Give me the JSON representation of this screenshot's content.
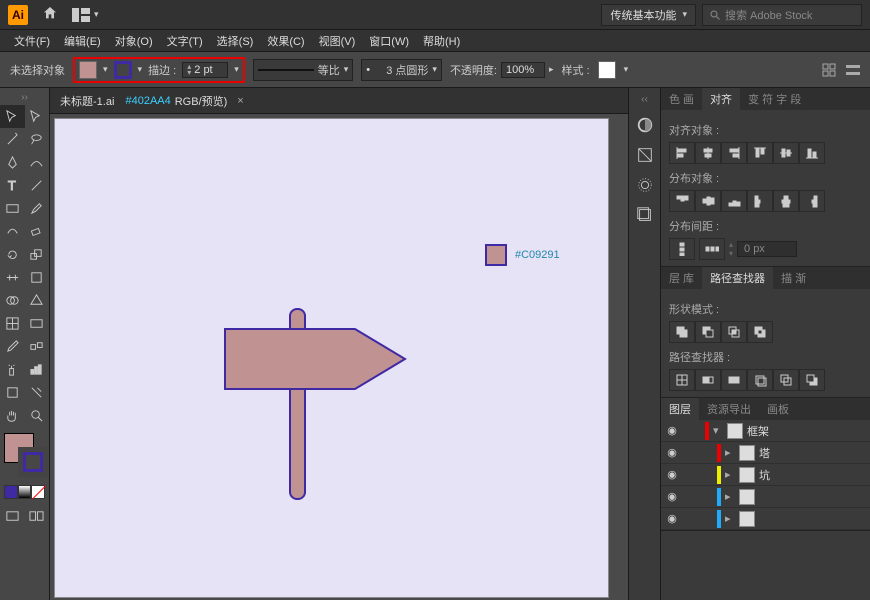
{
  "app": {
    "logo": "Ai"
  },
  "workspace": {
    "label": "传统基本功能",
    "search_placeholder": "搜索 Adobe Stock"
  },
  "menu": [
    "文件(F)",
    "编辑(E)",
    "对象(O)",
    "文字(T)",
    "选择(S)",
    "效果(C)",
    "视图(V)",
    "窗口(W)",
    "帮助(H)"
  ],
  "control": {
    "no_sel": "未选择对象",
    "fill_color": "#C09291",
    "stroke_color": "#402AA4",
    "stroke_label": "描边 :",
    "stroke_weight": "2 pt",
    "ratio_label": "等比",
    "dash_label": "3 点圆形",
    "opacity_label": "不透明度:",
    "opacity_value": "100%",
    "style_label": "样式 :"
  },
  "doc": {
    "prefix": "未标题-1.ai",
    "highlight": "#402AA4",
    "suffix": "RGB/预览)"
  },
  "canvas": {
    "callout_color": "#C09291"
  },
  "align": {
    "tabs": [
      "色 画",
      "对齐",
      "变 符 字 段"
    ],
    "sec1": "对齐对象 :",
    "sec2": "分布对象 :",
    "sec3": "分布间距 :",
    "spacing": "0 px"
  },
  "pathfinder": {
    "tabs": [
      "层 库",
      "路径查找器",
      "描 渐"
    ],
    "sec1": "形状模式 :",
    "sec2": "路径查找器 :"
  },
  "layers": {
    "tabs": [
      "图层",
      "资源导出",
      "画板"
    ],
    "items": [
      {
        "name": "框架",
        "color": "#e00",
        "indent": 0
      },
      {
        "name": "塔",
        "color": "#e00",
        "indent": 1
      },
      {
        "name": "坑",
        "color": "#ee0",
        "indent": 1
      },
      {
        "name": "",
        "color": "#2af",
        "indent": 1
      },
      {
        "name": "",
        "color": "#2af",
        "indent": 1
      }
    ]
  }
}
